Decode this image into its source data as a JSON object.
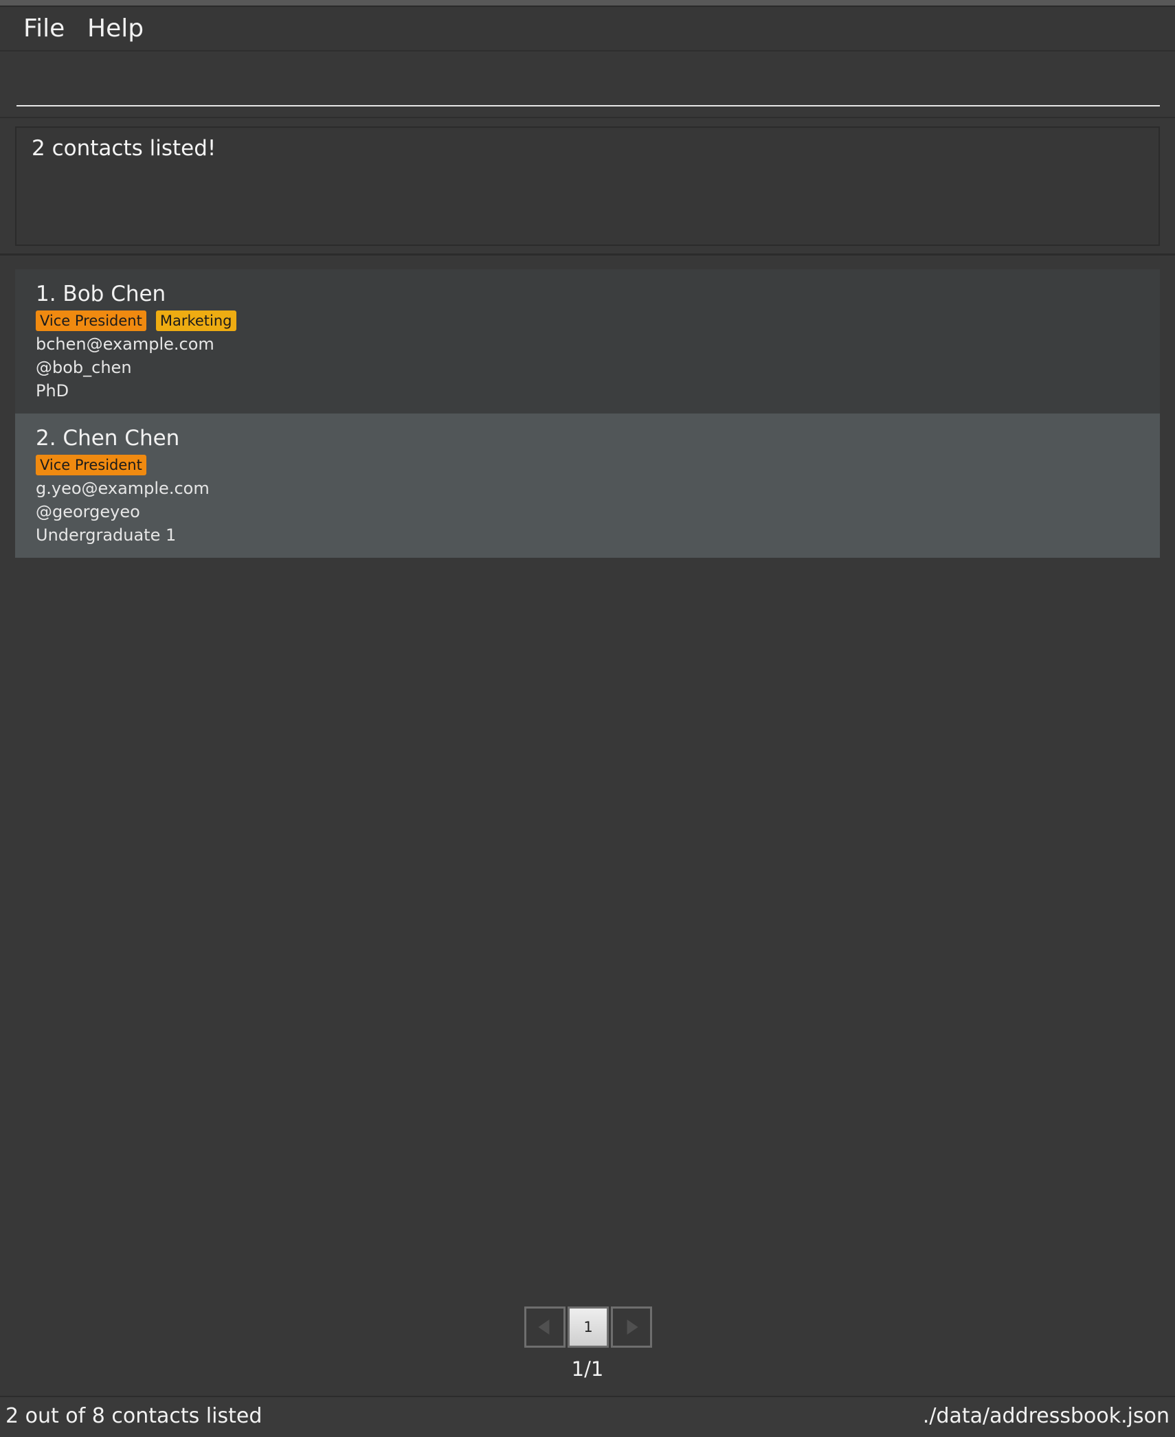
{
  "menu": {
    "file_label": "File",
    "help_label": "Help"
  },
  "command": {
    "value": "",
    "placeholder": ""
  },
  "result": {
    "message": "2 contacts listed!"
  },
  "contacts": [
    {
      "name": "1. Bob Chen",
      "tags": [
        "Vice President",
        "Marketing"
      ],
      "email": "bchen@example.com",
      "handle": "@bob_chen",
      "detail": "PhD"
    },
    {
      "name": "2. Chen Chen",
      "tags": [
        "Vice President"
      ],
      "email": "g.yeo@example.com",
      "handle": "@georgeyeo",
      "detail": "Undergraduate 1"
    }
  ],
  "pagination": {
    "current_page": "1",
    "page_count_label": "1/1"
  },
  "status": {
    "listed": "2 out of 8 contacts listed",
    "file_path": "./data/addressbook.json"
  },
  "colors": {
    "background": "#383838",
    "selected_card": "#515658",
    "tag_orange": "#f08a10",
    "tag_yellow": "#eeac12"
  }
}
